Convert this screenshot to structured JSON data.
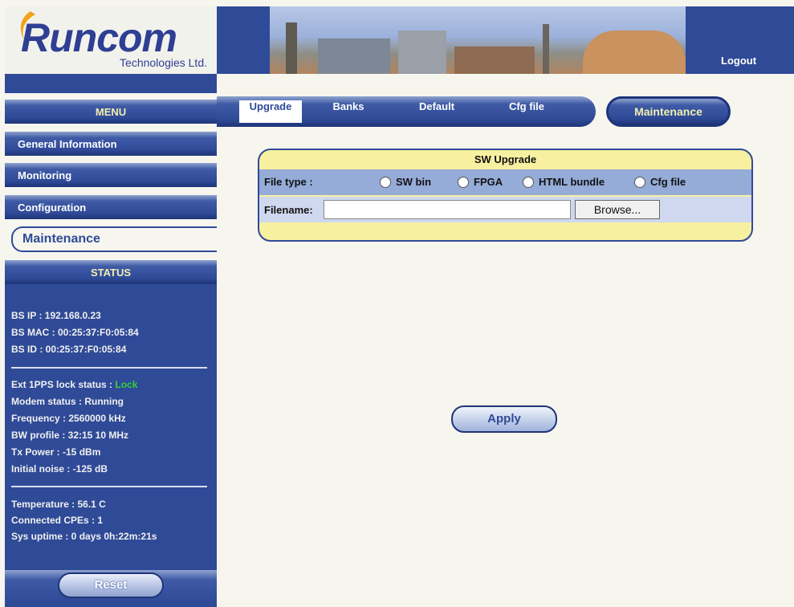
{
  "header": {
    "logo_text": "Runcom",
    "logo_subtext": "Technologies Ltd.",
    "logout_label": "Logout"
  },
  "sidebar": {
    "menu_title": "MENU",
    "items": [
      {
        "label": "General Information"
      },
      {
        "label": "Monitoring"
      },
      {
        "label": "Configuration"
      },
      {
        "label": "Maintenance"
      }
    ],
    "status_title": "STATUS",
    "status": {
      "bs_ip": "BS IP : 192.168.0.23",
      "bs_mac": "BS MAC : 00:25:37:F0:05:84",
      "bs_id": "BS ID : 00:25:37:F0:05:84",
      "ext_lock_label": "Ext 1PPS lock status :",
      "ext_lock_value": "Lock",
      "modem_status": "Modem status : Running",
      "frequency": "Frequency : 2560000 kHz",
      "bw_profile": "BW profile : 32:15 10 MHz",
      "tx_power": "Tx Power : -15 dBm",
      "initial_noise": "Initial noise : -125 dB",
      "temperature": "Temperature : 56.1 C",
      "connected_cpes": "Connected CPEs : 1",
      "sys_uptime": "Sys uptime : 0 days 0h:22m:21s"
    },
    "reset_label": "Reset"
  },
  "nav": {
    "tabs": [
      {
        "label": "Upgrade"
      },
      {
        "label": "Banks"
      },
      {
        "label": "Default"
      },
      {
        "label": "Cfg file"
      }
    ],
    "section_label": "Maintenance"
  },
  "upgrade": {
    "title": "SW Upgrade",
    "file_type_label": "File type :",
    "options": [
      {
        "label": "SW bin"
      },
      {
        "label": "FPGA"
      },
      {
        "label": "HTML bundle"
      },
      {
        "label": "Cfg file"
      }
    ],
    "filename_label": "Filename:",
    "filename_value": "",
    "browse_label": "Browse..."
  },
  "apply_label": "Apply",
  "colors": {
    "brand_blue": "#2f4a97",
    "accent_yellow": "#f7f0a0",
    "lock_green": "#35d13b",
    "background": "#f6f6ef"
  }
}
